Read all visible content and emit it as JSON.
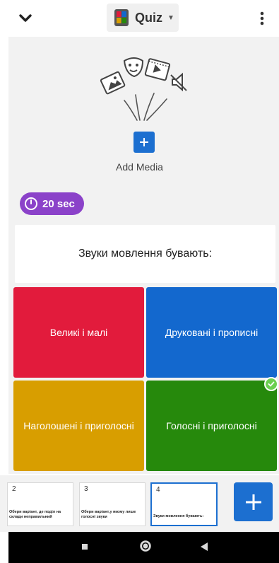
{
  "header": {
    "question_type": "Quiz",
    "icons": {
      "collapse": "chevron-down-icon",
      "type": "quiz-icon",
      "menu": "more-vertical-icon"
    }
  },
  "media": {
    "add_label": "Add Media",
    "icons": [
      "image-icon",
      "theater-mask-icon",
      "video-icon",
      "audio-muted-icon",
      "plus-icon"
    ]
  },
  "timer": {
    "label": "20 sec",
    "icon": "clock-icon",
    "color": "#8b42c9"
  },
  "question": {
    "text": "Звуки мовлення бувають:"
  },
  "answers": [
    {
      "text": "Великі і малі",
      "color": "#e21b3c",
      "correct": false
    },
    {
      "text": "Друковані і прописні",
      "color": "#1368ce",
      "correct": false
    },
    {
      "text": "Наголошені і приголосні",
      "color": "#d89e00",
      "correct": false
    },
    {
      "text": "Голосні і приголосні",
      "color": "#26890c",
      "correct": true
    }
  ],
  "slides": [
    {
      "number": "2",
      "text": "Обери варіант, де поділ на склади неправильний"
    },
    {
      "number": "3",
      "text": "Обери варіант,у якому лише голосні звуки"
    },
    {
      "number": "4",
      "text": "Звуки мовлення бувають:",
      "selected": true
    }
  ],
  "add_slide": {
    "icon": "plus-icon"
  },
  "colors": {
    "accent": "#1c6fd0",
    "correct_badge": "#6ccf50"
  }
}
